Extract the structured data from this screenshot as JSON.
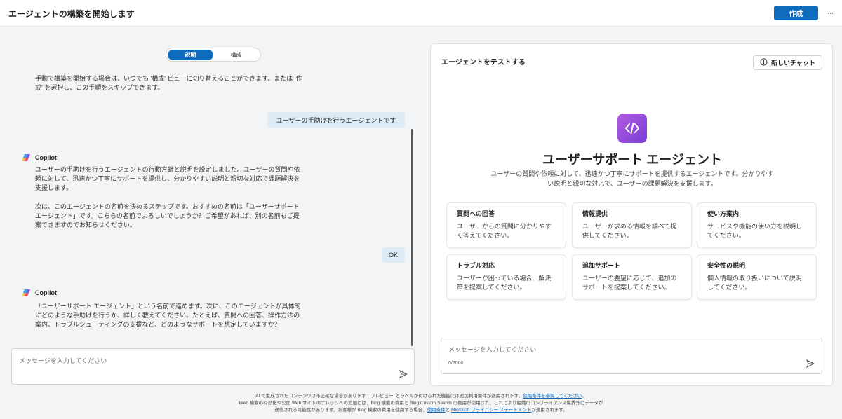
{
  "header": {
    "title": "エージェントの構築を開始します",
    "create_label": "作成",
    "more_label": "···"
  },
  "toggle": {
    "describe": "説明",
    "configure": "構成"
  },
  "chat": {
    "intro": "手動で構築を開始する場合は、いつでも '構成' ビューに切り替えることができます。または '作成' を選択し、この手順をスキップできます。",
    "user_msg_1": "ユーザーの手助けを行うエージェントです",
    "copilot_name": "Copilot",
    "copilot_msg_1a": "ユーザーの手助けを行うエージェントの行動方針と説明を設定しました。ユーザーの質問や依頼に対して、迅速かつ丁寧にサポートを提供し、分かりやすい説明と親切な対応で課題解決を支援します。",
    "copilot_msg_1b": "次は、このエージェントの名前を決めるステップです。おすすめの名前は「ユーザーサポート エージェント」です。こちらの名前でよろしいでしょうか？ご希望があれば、別の名前もご提案できますのでお知らせください。",
    "user_msg_2": "OK",
    "copilot_msg_2": "「ユーザーサポート エージェント」という名前で進めます。次に、このエージェントが具体的にどのような手助けを行うか、詳しく教えてください。たとえば、質問への回答、操作方法の案内、トラブルシューティングの支援など、どのようなサポートを想定していますか？",
    "input_placeholder": "メッセージを入力してください"
  },
  "test_panel": {
    "title": "エージェントをテストする",
    "new_chat_label": "新しいチャット",
    "agent_name": "ユーザーサポート エージェント",
    "agent_desc": "ユーザーの質問や依頼に対して、迅速かつ丁寧にサポートを提供するエージェントです。分かりやすい説明と親切な対応で、ユーザーの課題解決を支援します。",
    "cards": [
      {
        "title": "質問への回答",
        "desc": "ユーザーからの質問に分かりやすく答えてください。"
      },
      {
        "title": "情報提供",
        "desc": "ユーザーが求める情報を調べて提供してください。"
      },
      {
        "title": "使い方案内",
        "desc": "サービスや機能の使い方を説明してください。"
      },
      {
        "title": "トラブル対応",
        "desc": "ユーザーが困っている場合、解決策を提案してください。"
      },
      {
        "title": "追加サポート",
        "desc": "ユーザーの要望に応じて、追加のサポートを提案してください。"
      },
      {
        "title": "安全性の説明",
        "desc": "個人情報の取り扱いについて説明してください。"
      }
    ],
    "input_placeholder": "メッセージを入力してください",
    "char_count": "0/2000"
  },
  "footer": {
    "line1_text": "AI で生成されたコンテンツは不正確な場合があります | 'プレビュー' とラベルが付けられた機能には追加利用条件が適用されます。",
    "line1_link": "使用条件を参照してください",
    "line1_end": "。",
    "line2": "Web 検索の有効化や公開 Web サイトのナレッジへの追加には、Bing 検索の費用と Bing Custom Search の費用が使用され、これにより組織のコンプライアンス境界外にデータが",
    "line3_text": "送信される可能性があります。お客様が Bing 検索の費用を使用する場合、",
    "line3_link1": "使用条件",
    "line3_mid": "と",
    "line3_link2": "Microsoft プライバシー ステートメント",
    "line3_end": "が適用されます。"
  }
}
